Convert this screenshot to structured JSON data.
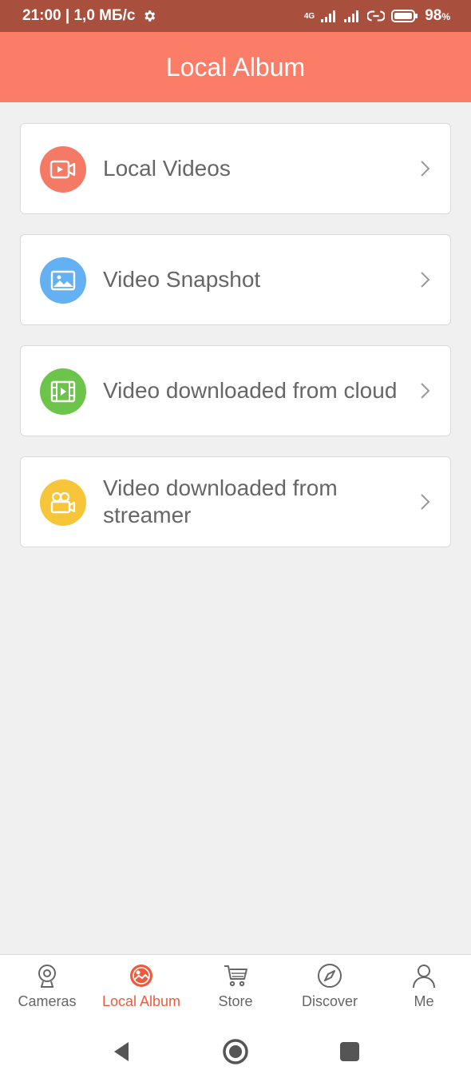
{
  "status_bar": {
    "time_speed": "21:00 | 1,0 МБ/с",
    "network": "4G",
    "battery": "98",
    "battery_unit": "%"
  },
  "header": {
    "title": "Local Album"
  },
  "menu": [
    {
      "label": "Local Videos",
      "icon": "video-camera-icon",
      "color": "#f57a65"
    },
    {
      "label": "Video Snapshot",
      "icon": "image-icon",
      "color": "#63b0f2"
    },
    {
      "label": "Video downloaded from cloud",
      "icon": "film-icon",
      "color": "#6cc44a"
    },
    {
      "label": "Video downloaded from streamer",
      "icon": "camcorder-icon",
      "color": "#f7c53a"
    }
  ],
  "tabs": [
    {
      "label": "Cameras",
      "icon": "webcam-icon",
      "active": false
    },
    {
      "label": "Local Album",
      "icon": "album-icon",
      "active": true
    },
    {
      "label": "Store",
      "icon": "cart-icon",
      "active": false
    },
    {
      "label": "Discover",
      "icon": "compass-icon",
      "active": false
    },
    {
      "label": "Me",
      "icon": "person-icon",
      "active": false
    }
  ],
  "colors": {
    "header_bg": "#fb7d67",
    "status_bg": "#a84f3e",
    "active_tab": "#ef5a3c",
    "page_bg": "#f0f0f0"
  }
}
